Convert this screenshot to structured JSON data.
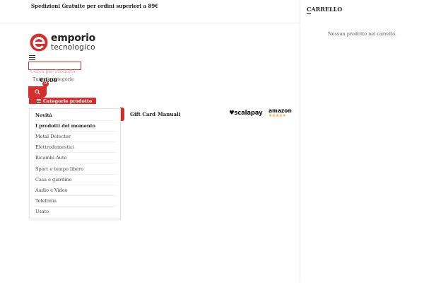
{
  "topbar": {
    "shipping_text": "Spedizioni Gratuite per ordini superiori a 89€"
  },
  "cart_panel": {
    "title": "CARRELLO",
    "empty_text": "Nessun prodotto nel carrello."
  },
  "logo": {
    "line1": "emporio",
    "line2": "tecnologico",
    "brand_color": "#d32f2f"
  },
  "search": {
    "placeholder": "Cerca per Prodotto",
    "category_select": "Tutte le categorie",
    "button_icon": "search-icon"
  },
  "cart": {
    "total": "€0.00",
    "count": "0",
    "icon": "cart-icon"
  },
  "categories_button": {
    "label": "Categorie prodotto",
    "icon": "list-icon"
  },
  "nav": {
    "gift_card": "Gift Card",
    "manuali": "Manuali"
  },
  "partners": {
    "scalapay": "scalapay",
    "amazon": "amazon",
    "amazon_stars": "★★★★★"
  },
  "categories": [
    {
      "label": "Novità",
      "bold": true
    },
    {
      "label": "I prodotti del momento",
      "bold": true
    },
    {
      "label": "Metal Detector",
      "bold": false
    },
    {
      "label": "Elettrodomestici",
      "bold": false
    },
    {
      "label": "Ricambi Auto",
      "bold": false
    },
    {
      "label": "Sport e tempo libero",
      "bold": false
    },
    {
      "label": "Casa e giardino",
      "bold": false
    },
    {
      "label": "Audio e Video",
      "bold": false
    },
    {
      "label": "Telefonia",
      "bold": false
    },
    {
      "label": "Usato",
      "bold": false
    }
  ],
  "colors": {
    "accent": "#d32f2f",
    "text": "#222222",
    "star": "#f5a623"
  }
}
